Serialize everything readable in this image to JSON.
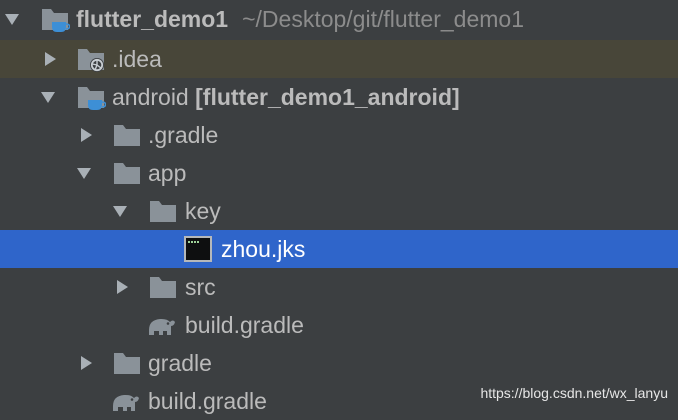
{
  "tree": {
    "root": {
      "name": "flutter_demo1",
      "path": "~/Desktop/git/flutter_demo1"
    },
    "idea": {
      "name": ".idea"
    },
    "android": {
      "name": "android",
      "module": "[flutter_demo1_android]"
    },
    "gradle_dot": {
      "name": ".gradle"
    },
    "app": {
      "name": "app"
    },
    "key": {
      "name": "key"
    },
    "jks": {
      "name": "zhou.jks"
    },
    "src": {
      "name": "src"
    },
    "app_build_gradle": {
      "name": "build.gradle"
    },
    "gradle": {
      "name": "gradle"
    },
    "android_build_gradle": {
      "name": "build.gradle"
    }
  },
  "watermark": "https://blog.csdn.net/wx_lanyu",
  "colors": {
    "background": "#3c3f41",
    "selection": "#2f65ca",
    "project_band": "#484639",
    "folder": "#8a9299",
    "module_badge": "#3d8fd6"
  },
  "icons": {
    "expanded": "chevron-down-icon",
    "collapsed": "chevron-right-icon",
    "folder": "folder-icon",
    "module_folder": "module-folder-icon",
    "idea_folder": "idea-folder-icon",
    "keystore_file": "terminal-file-icon",
    "gradle_file": "gradle-elephant-icon"
  }
}
